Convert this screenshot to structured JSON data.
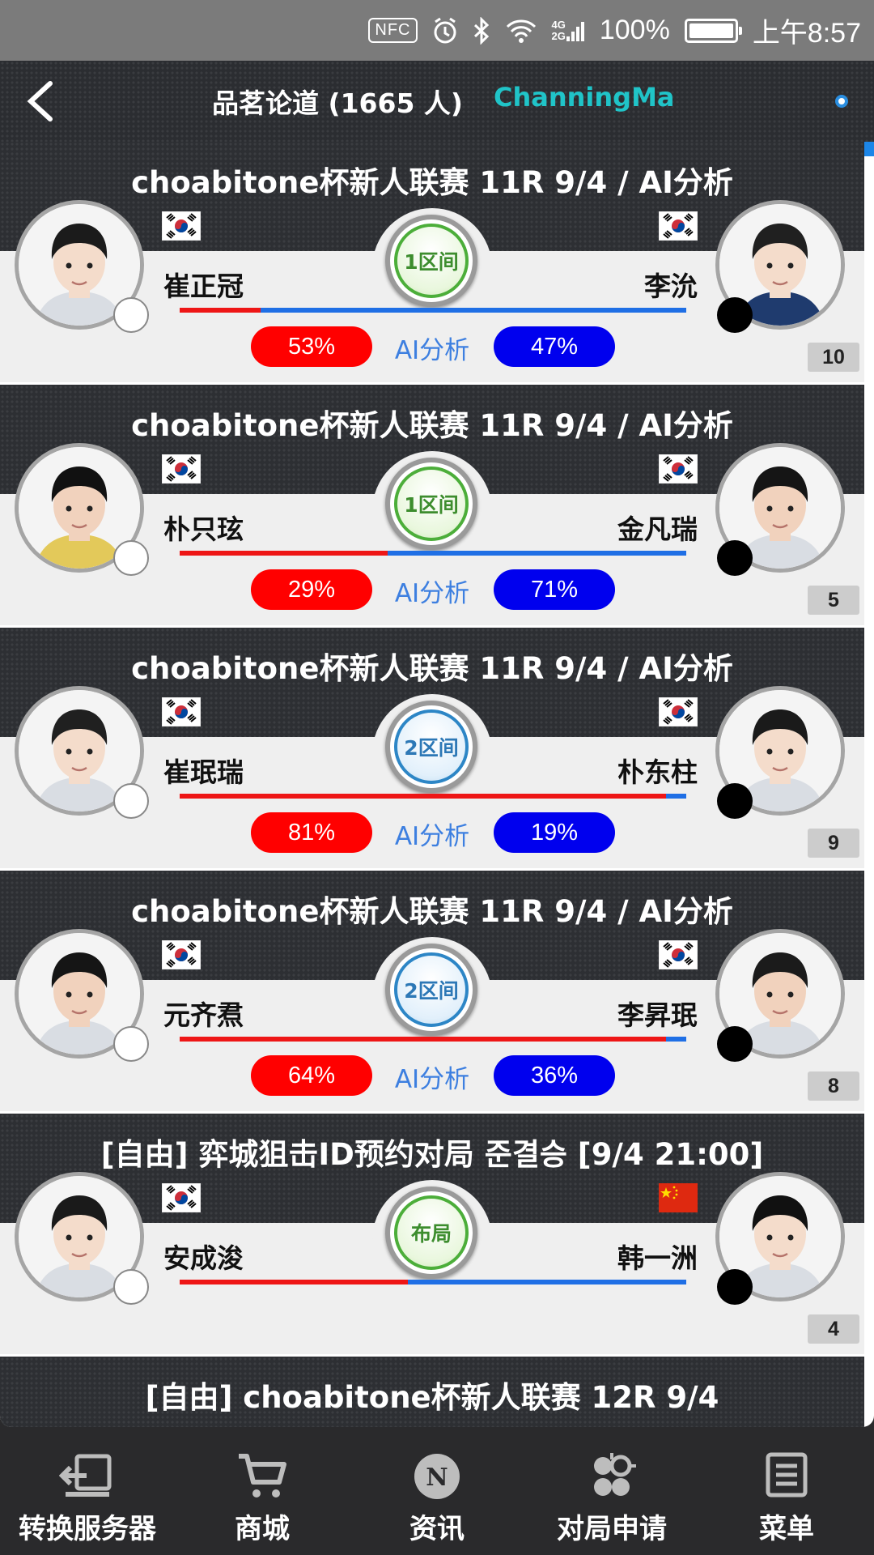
{
  "status_bar": {
    "nfc": "NFC",
    "net_top": "4G",
    "net_bottom": "2G",
    "battery": "100%",
    "time": "上午8:57"
  },
  "header": {
    "title": "品茗论道 (1665 人)",
    "user": "ChanningMa",
    "accent_color": "#20c4c8"
  },
  "ai_label": "AI分析",
  "games": [
    {
      "title": "choabitone杯新人联赛  11R 9/4 / AI分析",
      "stage": "1区间",
      "stage_color": "green",
      "left": {
        "name": "崔正冠",
        "flag": "korea"
      },
      "right": {
        "name": "李沇",
        "flag": "korea"
      },
      "red_share": 0.16,
      "left_pct": "53%",
      "right_pct": "47%",
      "count": "10"
    },
    {
      "title": "choabitone杯新人联赛  11R 9/4 / AI分析",
      "stage": "1区间",
      "stage_color": "green",
      "left": {
        "name": "朴只玹",
        "flag": "korea"
      },
      "right": {
        "name": "金凡瑞",
        "flag": "korea"
      },
      "red_share": 0.41,
      "left_pct": "29%",
      "right_pct": "71%",
      "count": "5"
    },
    {
      "title": "choabitone杯新人联赛  11R 9/4 / AI分析",
      "stage": "2区间",
      "stage_color": "blue",
      "left": {
        "name": "崔珉瑞",
        "flag": "korea"
      },
      "right": {
        "name": "朴东柱",
        "flag": "korea"
      },
      "red_share": 0.96,
      "left_pct": "81%",
      "right_pct": "19%",
      "count": "9"
    },
    {
      "title": "choabitone杯新人联赛  11R 9/4 / AI分析",
      "stage": "2区间",
      "stage_color": "blue",
      "left": {
        "name": "元齐焄",
        "flag": "korea"
      },
      "right": {
        "name": "李昇珉",
        "flag": "korea"
      },
      "red_share": 0.96,
      "left_pct": "64%",
      "right_pct": "36%",
      "count": "8"
    },
    {
      "title": "[自由] 弈城狙击ID预约对局  준결승 [9/4 21:00]",
      "stage": "布局",
      "stage_color": "green",
      "left": {
        "name": "安成浚",
        "flag": "korea"
      },
      "right": {
        "name": "韩一洲",
        "flag": "china"
      },
      "red_share": 0.45,
      "left_pct": "",
      "right_pct": "",
      "count": "4"
    }
  ],
  "partial_title": "[自由] choabitone杯新人联赛  12R 9/4",
  "nav": [
    {
      "label": "转换服务器",
      "icon": "switch-server-icon"
    },
    {
      "label": "商城",
      "icon": "cart-icon"
    },
    {
      "label": "资讯",
      "icon": "news-icon"
    },
    {
      "label": "对局申请",
      "icon": "game-request-icon"
    },
    {
      "label": "菜单",
      "icon": "menu-icon"
    }
  ]
}
